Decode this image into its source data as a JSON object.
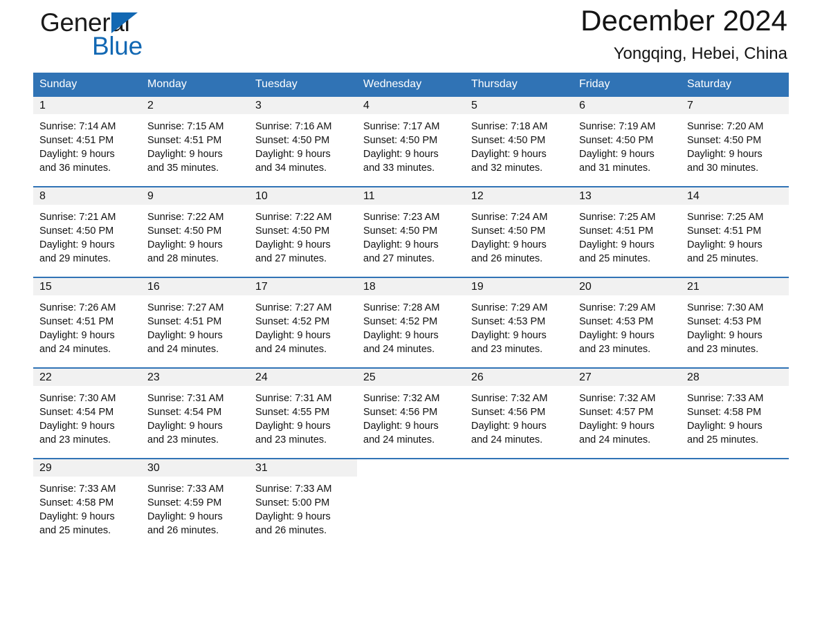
{
  "brand": {
    "name_part1": "General",
    "name_part2": "Blue",
    "triangle_color": "#1268b3"
  },
  "header": {
    "title": "December 2024",
    "subtitle": "Yongqing, Hebei, China",
    "accent_color": "#3073b5",
    "daynum_band_color": "#f1f1f1"
  },
  "weekdays": [
    "Sunday",
    "Monday",
    "Tuesday",
    "Wednesday",
    "Thursday",
    "Friday",
    "Saturday"
  ],
  "weeks": [
    [
      {
        "day": "1",
        "sunrise": "Sunrise: 7:14 AM",
        "sunset": "Sunset: 4:51 PM",
        "daylight_line1": "Daylight: 9 hours",
        "daylight_line2": "and 36 minutes."
      },
      {
        "day": "2",
        "sunrise": "Sunrise: 7:15 AM",
        "sunset": "Sunset: 4:51 PM",
        "daylight_line1": "Daylight: 9 hours",
        "daylight_line2": "and 35 minutes."
      },
      {
        "day": "3",
        "sunrise": "Sunrise: 7:16 AM",
        "sunset": "Sunset: 4:50 PM",
        "daylight_line1": "Daylight: 9 hours",
        "daylight_line2": "and 34 minutes."
      },
      {
        "day": "4",
        "sunrise": "Sunrise: 7:17 AM",
        "sunset": "Sunset: 4:50 PM",
        "daylight_line1": "Daylight: 9 hours",
        "daylight_line2": "and 33 minutes."
      },
      {
        "day": "5",
        "sunrise": "Sunrise: 7:18 AM",
        "sunset": "Sunset: 4:50 PM",
        "daylight_line1": "Daylight: 9 hours",
        "daylight_line2": "and 32 minutes."
      },
      {
        "day": "6",
        "sunrise": "Sunrise: 7:19 AM",
        "sunset": "Sunset: 4:50 PM",
        "daylight_line1": "Daylight: 9 hours",
        "daylight_line2": "and 31 minutes."
      },
      {
        "day": "7",
        "sunrise": "Sunrise: 7:20 AM",
        "sunset": "Sunset: 4:50 PM",
        "daylight_line1": "Daylight: 9 hours",
        "daylight_line2": "and 30 minutes."
      }
    ],
    [
      {
        "day": "8",
        "sunrise": "Sunrise: 7:21 AM",
        "sunset": "Sunset: 4:50 PM",
        "daylight_line1": "Daylight: 9 hours",
        "daylight_line2": "and 29 minutes."
      },
      {
        "day": "9",
        "sunrise": "Sunrise: 7:22 AM",
        "sunset": "Sunset: 4:50 PM",
        "daylight_line1": "Daylight: 9 hours",
        "daylight_line2": "and 28 minutes."
      },
      {
        "day": "10",
        "sunrise": "Sunrise: 7:22 AM",
        "sunset": "Sunset: 4:50 PM",
        "daylight_line1": "Daylight: 9 hours",
        "daylight_line2": "and 27 minutes."
      },
      {
        "day": "11",
        "sunrise": "Sunrise: 7:23 AM",
        "sunset": "Sunset: 4:50 PM",
        "daylight_line1": "Daylight: 9 hours",
        "daylight_line2": "and 27 minutes."
      },
      {
        "day": "12",
        "sunrise": "Sunrise: 7:24 AM",
        "sunset": "Sunset: 4:50 PM",
        "daylight_line1": "Daylight: 9 hours",
        "daylight_line2": "and 26 minutes."
      },
      {
        "day": "13",
        "sunrise": "Sunrise: 7:25 AM",
        "sunset": "Sunset: 4:51 PM",
        "daylight_line1": "Daylight: 9 hours",
        "daylight_line2": "and 25 minutes."
      },
      {
        "day": "14",
        "sunrise": "Sunrise: 7:25 AM",
        "sunset": "Sunset: 4:51 PM",
        "daylight_line1": "Daylight: 9 hours",
        "daylight_line2": "and 25 minutes."
      }
    ],
    [
      {
        "day": "15",
        "sunrise": "Sunrise: 7:26 AM",
        "sunset": "Sunset: 4:51 PM",
        "daylight_line1": "Daylight: 9 hours",
        "daylight_line2": "and 24 minutes."
      },
      {
        "day": "16",
        "sunrise": "Sunrise: 7:27 AM",
        "sunset": "Sunset: 4:51 PM",
        "daylight_line1": "Daylight: 9 hours",
        "daylight_line2": "and 24 minutes."
      },
      {
        "day": "17",
        "sunrise": "Sunrise: 7:27 AM",
        "sunset": "Sunset: 4:52 PM",
        "daylight_line1": "Daylight: 9 hours",
        "daylight_line2": "and 24 minutes."
      },
      {
        "day": "18",
        "sunrise": "Sunrise: 7:28 AM",
        "sunset": "Sunset: 4:52 PM",
        "daylight_line1": "Daylight: 9 hours",
        "daylight_line2": "and 24 minutes."
      },
      {
        "day": "19",
        "sunrise": "Sunrise: 7:29 AM",
        "sunset": "Sunset: 4:53 PM",
        "daylight_line1": "Daylight: 9 hours",
        "daylight_line2": "and 23 minutes."
      },
      {
        "day": "20",
        "sunrise": "Sunrise: 7:29 AM",
        "sunset": "Sunset: 4:53 PM",
        "daylight_line1": "Daylight: 9 hours",
        "daylight_line2": "and 23 minutes."
      },
      {
        "day": "21",
        "sunrise": "Sunrise: 7:30 AM",
        "sunset": "Sunset: 4:53 PM",
        "daylight_line1": "Daylight: 9 hours",
        "daylight_line2": "and 23 minutes."
      }
    ],
    [
      {
        "day": "22",
        "sunrise": "Sunrise: 7:30 AM",
        "sunset": "Sunset: 4:54 PM",
        "daylight_line1": "Daylight: 9 hours",
        "daylight_line2": "and 23 minutes."
      },
      {
        "day": "23",
        "sunrise": "Sunrise: 7:31 AM",
        "sunset": "Sunset: 4:54 PM",
        "daylight_line1": "Daylight: 9 hours",
        "daylight_line2": "and 23 minutes."
      },
      {
        "day": "24",
        "sunrise": "Sunrise: 7:31 AM",
        "sunset": "Sunset: 4:55 PM",
        "daylight_line1": "Daylight: 9 hours",
        "daylight_line2": "and 23 minutes."
      },
      {
        "day": "25",
        "sunrise": "Sunrise: 7:32 AM",
        "sunset": "Sunset: 4:56 PM",
        "daylight_line1": "Daylight: 9 hours",
        "daylight_line2": "and 24 minutes."
      },
      {
        "day": "26",
        "sunrise": "Sunrise: 7:32 AM",
        "sunset": "Sunset: 4:56 PM",
        "daylight_line1": "Daylight: 9 hours",
        "daylight_line2": "and 24 minutes."
      },
      {
        "day": "27",
        "sunrise": "Sunrise: 7:32 AM",
        "sunset": "Sunset: 4:57 PM",
        "daylight_line1": "Daylight: 9 hours",
        "daylight_line2": "and 24 minutes."
      },
      {
        "day": "28",
        "sunrise": "Sunrise: 7:33 AM",
        "sunset": "Sunset: 4:58 PM",
        "daylight_line1": "Daylight: 9 hours",
        "daylight_line2": "and 25 minutes."
      }
    ],
    [
      {
        "day": "29",
        "sunrise": "Sunrise: 7:33 AM",
        "sunset": "Sunset: 4:58 PM",
        "daylight_line1": "Daylight: 9 hours",
        "daylight_line2": "and 25 minutes."
      },
      {
        "day": "30",
        "sunrise": "Sunrise: 7:33 AM",
        "sunset": "Sunset: 4:59 PM",
        "daylight_line1": "Daylight: 9 hours",
        "daylight_line2": "and 26 minutes."
      },
      {
        "day": "31",
        "sunrise": "Sunrise: 7:33 AM",
        "sunset": "Sunset: 5:00 PM",
        "daylight_line1": "Daylight: 9 hours",
        "daylight_line2": "and 26 minutes."
      },
      {
        "day": "",
        "sunrise": "",
        "sunset": "",
        "daylight_line1": "",
        "daylight_line2": ""
      },
      {
        "day": "",
        "sunrise": "",
        "sunset": "",
        "daylight_line1": "",
        "daylight_line2": ""
      },
      {
        "day": "",
        "sunrise": "",
        "sunset": "",
        "daylight_line1": "",
        "daylight_line2": ""
      },
      {
        "day": "",
        "sunrise": "",
        "sunset": "",
        "daylight_line1": "",
        "daylight_line2": ""
      }
    ]
  ]
}
